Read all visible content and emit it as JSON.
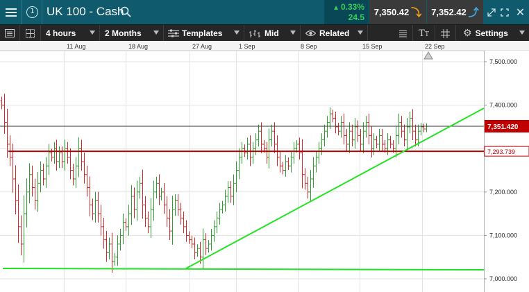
{
  "header": {
    "title": "UK 100 - Cash",
    "change_percent": "0.33%",
    "change_points": "24.5",
    "sell_price": "7,350.42",
    "buy_price": "7,352.42",
    "info_label": "1"
  },
  "toolbar": {
    "interval": "4 hours",
    "range": "2 Months",
    "templates": "Templates",
    "price_type": "Mid",
    "related": "Related",
    "settings": "Settings"
  },
  "colors": {
    "header_bg": "#0f5a6c",
    "toolbar_bg": "#262626",
    "up": "#2ca02c",
    "down": "#d62728",
    "trendline": "#22e322",
    "sell_tag": "#c00000",
    "level_line": "#c00000"
  },
  "chart_data": {
    "type": "ohlc",
    "x_labels": [
      "11 Aug",
      "18 Aug",
      "27 Aug",
      "1 Sep",
      "8 Sep",
      "15 Sep",
      "22 Sep"
    ],
    "y_ticks": [
      "7,000.000",
      "7,100.000",
      "7,200.000",
      "7,300.000",
      "7,400.000",
      "7,500.000"
    ],
    "ylim": [
      6990,
      7545
    ],
    "current_price": 7351.42,
    "current_price_label": "7,351.420",
    "level_price": 7293.739,
    "level_price_label": "7,293.739",
    "grid": true,
    "closes": [
      7400,
      7360,
      7310,
      7280,
      7230,
      7180,
      7120,
      7080,
      7150,
      7200,
      7240,
      7210,
      7180,
      7220,
      7250,
      7230,
      7260,
      7290,
      7280,
      7300,
      7270,
      7290,
      7270,
      7300,
      7280,
      7250,
      7230,
      7260,
      7300,
      7270,
      7240,
      7210,
      7170,
      7150,
      7180,
      7150,
      7120,
      7090,
      7060,
      7080,
      7040,
      7050,
      7080,
      7100,
      7130,
      7120,
      7150,
      7190,
      7160,
      7200,
      7220,
      7170,
      7140,
      7120,
      7160,
      7200,
      7220,
      7190,
      7200,
      7170,
      7140,
      7110,
      7160,
      7180,
      7160,
      7140,
      7120,
      7100,
      7090,
      7080,
      7060,
      7070,
      7050,
      7090,
      7070,
      7080,
      7100,
      7120,
      7140,
      7160,
      7170,
      7190,
      7210,
      7190,
      7220,
      7250,
      7280,
      7300,
      7290,
      7310,
      7280,
      7300,
      7320,
      7340,
      7310,
      7300,
      7280,
      7320,
      7340,
      7310,
      7280,
      7260,
      7250,
      7270,
      7260,
      7280,
      7300,
      7310,
      7290,
      7240,
      7220,
      7200,
      7230,
      7260,
      7280,
      7300,
      7320,
      7340,
      7360,
      7380,
      7370,
      7350,
      7340,
      7360,
      7330,
      7310,
      7340,
      7320,
      7350,
      7330,
      7310,
      7340,
      7360,
      7330,
      7300,
      7320,
      7310,
      7330,
      7310,
      7300,
      7320,
      7310,
      7300,
      7330,
      7360,
      7340,
      7320,
      7350,
      7370,
      7340,
      7320,
      7340,
      7350,
      7345,
      7351
    ]
  }
}
